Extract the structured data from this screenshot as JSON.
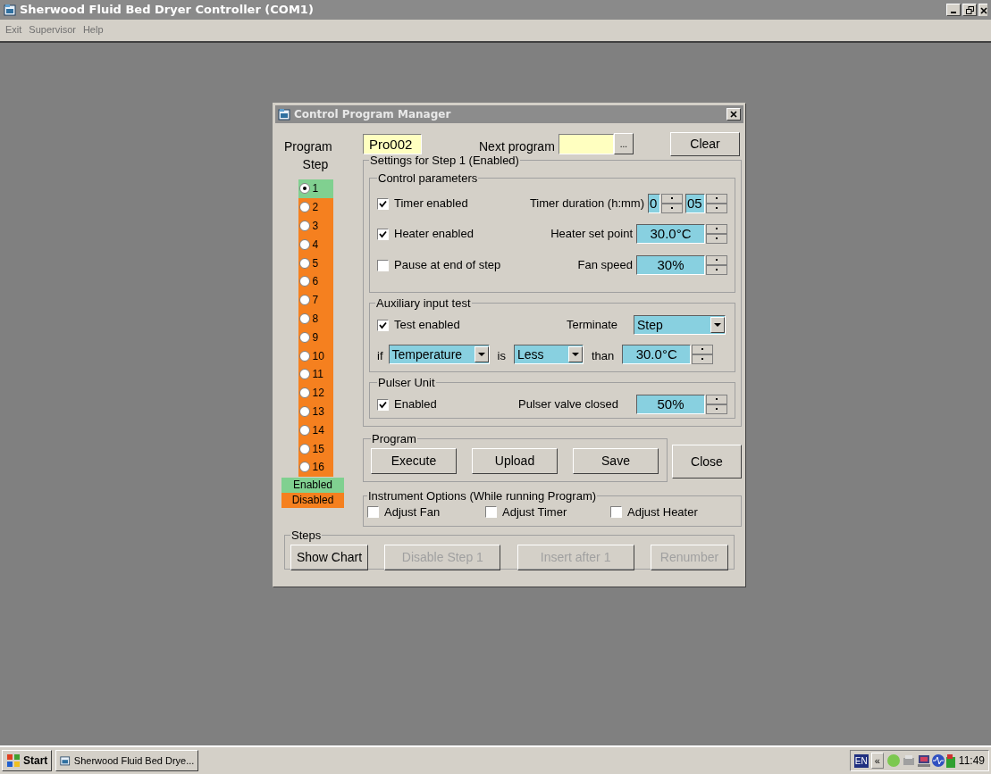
{
  "app_window": {
    "title": "Sherwood Fluid Bed Dryer Controller (COM1)"
  },
  "menu": [
    "Exit",
    "Supervisor",
    "Help"
  ],
  "dialog": {
    "title": "Control Program Manager",
    "program_label": "Program",
    "program_value": "Pro002",
    "next_program_label": "Next program",
    "browse_button": "...",
    "clear_button": "Clear",
    "step_label": "Step",
    "steps": [
      {
        "label": "1",
        "selected": true,
        "color": "#80d090"
      },
      {
        "label": "2",
        "selected": false,
        "color": "#f5801f"
      },
      {
        "label": "3",
        "selected": false,
        "color": "#f5801f"
      },
      {
        "label": "4",
        "selected": false,
        "color": "#f5801f"
      },
      {
        "label": "5",
        "selected": false,
        "color": "#f5801f"
      },
      {
        "label": "6",
        "selected": false,
        "color": "#f5801f"
      },
      {
        "label": "7",
        "selected": false,
        "color": "#f5801f"
      },
      {
        "label": "8",
        "selected": false,
        "color": "#f5801f"
      },
      {
        "label": "9",
        "selected": false,
        "color": "#f5801f"
      },
      {
        "label": "10",
        "selected": false,
        "color": "#f5801f"
      },
      {
        "label": "11",
        "selected": false,
        "color": "#f5801f"
      },
      {
        "label": "12",
        "selected": false,
        "color": "#f5801f"
      },
      {
        "label": "13",
        "selected": false,
        "color": "#f5801f"
      },
      {
        "label": "14",
        "selected": false,
        "color": "#f5801f"
      },
      {
        "label": "15",
        "selected": false,
        "color": "#f5801f"
      },
      {
        "label": "16",
        "selected": false,
        "color": "#f5801f"
      }
    ],
    "legend": [
      {
        "label": "Enabled",
        "color": "#80d090"
      },
      {
        "label": "Disabled",
        "color": "#f5801f"
      }
    ],
    "settings": {
      "title": "Settings for Step 1 (Enabled)",
      "control": {
        "title": "Control parameters",
        "timer": {
          "label": "Timer enabled",
          "checked": true
        },
        "timer_duration_label": "Timer duration (h:mm)",
        "hours": "0",
        "minutes": "05",
        "heater": {
          "label": "Heater enabled",
          "checked": true
        },
        "heater_set_point_label": "Heater set point",
        "heater_set_point": "30.0°C",
        "pause": {
          "label": "Pause at end of step",
          "checked": false
        },
        "fan_speed_label": "Fan speed",
        "fan_speed": "30%"
      },
      "aux": {
        "title": "Auxiliary input test",
        "test": {
          "label": "Test enabled",
          "checked": true
        },
        "terminate_label": "Terminate",
        "terminate": "Step",
        "if_label": "if",
        "variable": "Temperature",
        "is_label": "is",
        "comparison": "Less",
        "than_label": "than",
        "threshold": "30.0°C"
      },
      "pulser": {
        "title": "Pulser Unit",
        "enabled": {
          "label": "Enabled",
          "checked": true
        },
        "valve_label": "Pulser valve closed",
        "valve": "50%"
      }
    },
    "program_group": {
      "title": "Program",
      "buttons": [
        "Execute",
        "Upload",
        "Save"
      ]
    },
    "close_button": "Close",
    "instrument_options": {
      "title": "Instrument Options (While running Program)",
      "options": [
        {
          "label": "Adjust Fan",
          "checked": false
        },
        {
          "label": "Adjust Timer",
          "checked": false
        },
        {
          "label": "Adjust Heater",
          "checked": false
        }
      ]
    },
    "steps_group": {
      "title": "Steps",
      "buttons": [
        {
          "label": "Show Chart",
          "disabled": false
        },
        {
          "label": "Disable Step 1",
          "disabled": true
        },
        {
          "label": "Insert after 1",
          "disabled": true
        },
        {
          "label": "Renumber",
          "disabled": true
        }
      ]
    }
  },
  "taskbar": {
    "start": "Start",
    "tasks": [
      "Sherwood Fluid Bed Drye..."
    ],
    "language": "EN",
    "tray_toggle": "«",
    "clock": "11:49"
  }
}
